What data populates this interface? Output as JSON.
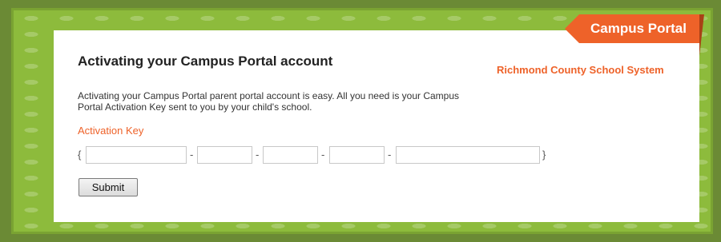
{
  "header": {
    "banner_label": "Campus Portal",
    "district_name": "Richmond County School System"
  },
  "main": {
    "title": "Activating your Campus Portal account",
    "description": "Activating your Campus Portal parent portal account is easy. All you need is your Campus Portal Activation Key sent to you by your child's school.",
    "key_label": "Activation Key",
    "open_brace": "{",
    "close_brace": "}",
    "separator": "-",
    "key_segments": [
      "",
      "",
      "",
      "",
      ""
    ],
    "submit_label": "Submit"
  },
  "colors": {
    "accent": "#ee6229",
    "frame_green": "#8dbb3c",
    "outer_green": "#6b8a35"
  }
}
